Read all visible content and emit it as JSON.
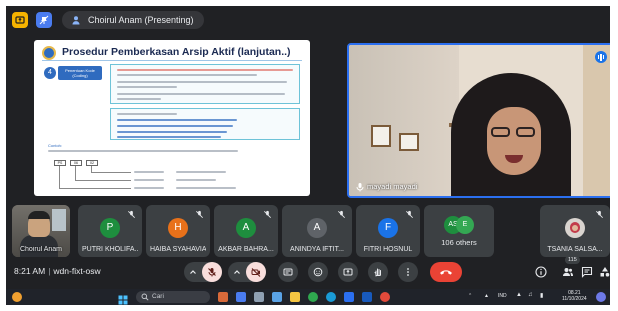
{
  "header": {
    "presenter_label": "Choirul Anam (Presenting)"
  },
  "presentation": {
    "slide_title": "Prosedur Pemberkasan Arsip Aktif (lanjutan..)",
    "step_number": "4",
    "step_label": "Penentuan Kode (Coding)",
    "small_label": "Contoh:",
    "example_codes": [
      "PS",
      "06",
      "02"
    ]
  },
  "speaker": {
    "name": "mayadi mayadi"
  },
  "participants": [
    {
      "name": "Choirul Anam",
      "type": "video"
    },
    {
      "name": "PUTRI KHOLIFA...",
      "initial": "P",
      "color": "#1e8e3e"
    },
    {
      "name": "HAIBA SYAHAVIA",
      "initial": "H",
      "color": "#e8711a"
    },
    {
      "name": "AKBAR BAHRA...",
      "initial": "A",
      "color": "#1e8e3e"
    },
    {
      "name": "ANINDYA IFTIT...",
      "initial": "A",
      "color": "#5f6368"
    },
    {
      "name": "FITRI HOSNUL",
      "initial": "F",
      "color": "#1a73e8"
    },
    {
      "name": "106 others",
      "initials": [
        "AS",
        "E"
      ],
      "colors": [
        "#1e8e3e",
        "#34a853"
      ]
    },
    {
      "name": "TSANIA SALSA...",
      "type": "photo"
    }
  ],
  "meeting": {
    "time": "8:21 AM",
    "separator": "|",
    "code": "wdn-fixt-osw"
  },
  "controls": {
    "people_count": "115"
  },
  "taskbar": {
    "search_placeholder": "Cari",
    "language": "IND",
    "clock_time": "08.21",
    "clock_date": "11/10/2024"
  },
  "colors": {
    "accent_blue": "#1a73e8",
    "end_call_red": "#ea4335",
    "background": "#202124"
  }
}
